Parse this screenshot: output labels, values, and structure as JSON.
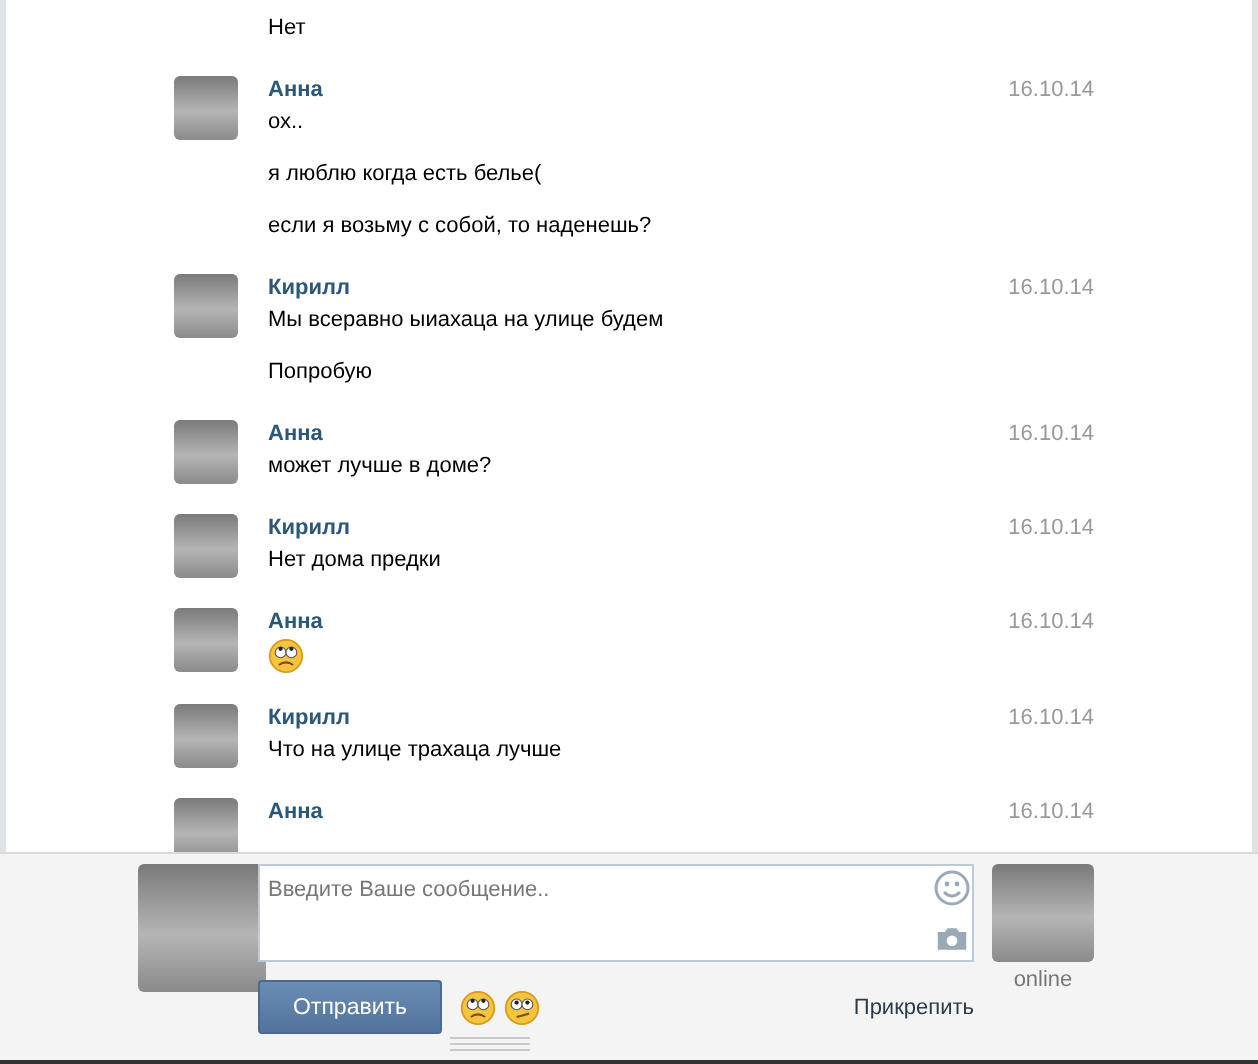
{
  "messages": [
    {
      "lines": [
        {
          "kind": "text",
          "text": "Нет"
        }
      ]
    },
    {
      "author": "Анна",
      "date": "16.10.14",
      "lines": [
        {
          "kind": "text",
          "text": "ох.."
        },
        {
          "kind": "text",
          "text": "я люблю когда есть белье("
        },
        {
          "kind": "text",
          "text": "если я возьму с собой, то наденешь?"
        }
      ]
    },
    {
      "author": "Кирилл",
      "date": "16.10.14",
      "lines": [
        {
          "kind": "text",
          "text": "Мы всеравно ыиахаца на улице будем"
        },
        {
          "kind": "text",
          "text": "Попробую"
        }
      ]
    },
    {
      "author": "Анна",
      "date": "16.10.14",
      "lines": [
        {
          "kind": "text",
          "text": "может лучше в доме?"
        }
      ]
    },
    {
      "author": "Кирилл",
      "date": "16.10.14",
      "lines": [
        {
          "kind": "text",
          "text": "Нет дома предки"
        }
      ]
    },
    {
      "author": "Анна",
      "date": "16.10.14",
      "lines": [
        {
          "kind": "emoji"
        }
      ]
    },
    {
      "author": "Кирилл",
      "date": "16.10.14",
      "lines": [
        {
          "kind": "text",
          "text": "Что на улице трахаца лучше"
        }
      ]
    },
    {
      "author": "Анна",
      "date": "16.10.14"
    }
  ],
  "composer": {
    "placeholder": "Введите Ваше сообщение..",
    "send_button": "Отправить",
    "attach_link": "Прикрепить",
    "partner_status": "online"
  }
}
